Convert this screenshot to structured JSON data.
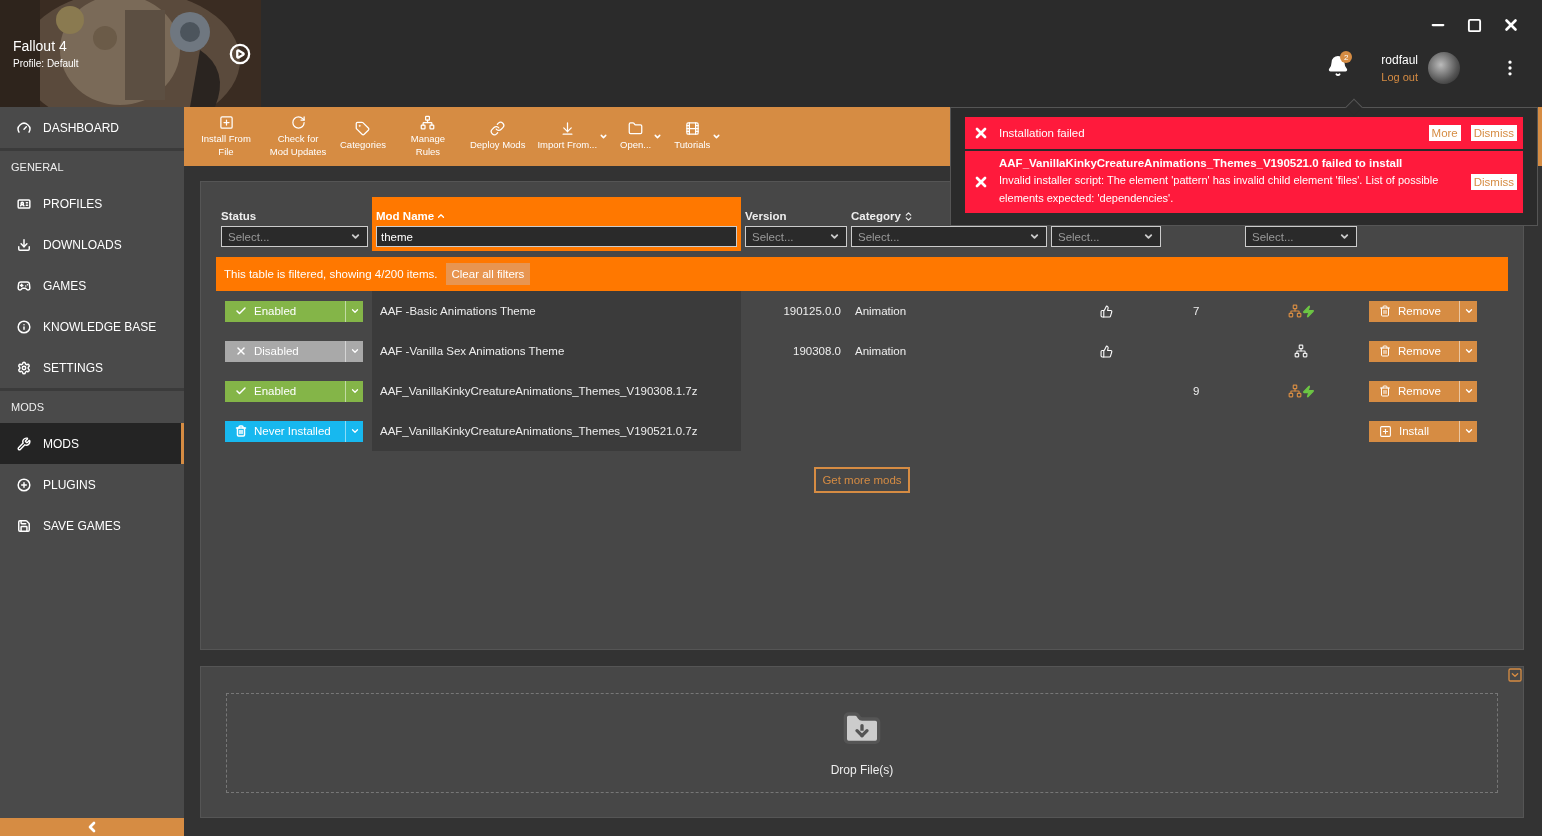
{
  "game": {
    "title": "Fallout 4",
    "profile": "Profile: Default"
  },
  "user": {
    "name": "rodfaul",
    "logout": "Log out",
    "notification_count": "2"
  },
  "sidebar": {
    "items": [
      {
        "kind": "item",
        "label": "DASHBOARD",
        "selected": false
      },
      {
        "kind": "section",
        "label": "GENERAL"
      },
      {
        "kind": "item",
        "label": "PROFILES",
        "selected": false
      },
      {
        "kind": "item",
        "label": "DOWNLOADS",
        "selected": false
      },
      {
        "kind": "item",
        "label": "GAMES",
        "selected": false
      },
      {
        "kind": "item",
        "label": "KNOWLEDGE BASE",
        "selected": false
      },
      {
        "kind": "item",
        "label": "SETTINGS",
        "selected": false
      },
      {
        "kind": "section",
        "label": "MODS"
      },
      {
        "kind": "item",
        "label": "MODS",
        "selected": true
      },
      {
        "kind": "item",
        "label": "PLUGINS",
        "selected": false
      },
      {
        "kind": "item",
        "label": "SAVE GAMES",
        "selected": false
      }
    ]
  },
  "toolbar": [
    {
      "label": "Install From File",
      "dropdown": false
    },
    {
      "label": "Check for Mod Updates",
      "dropdown": false
    },
    {
      "label": "Categories",
      "dropdown": false
    },
    {
      "label": "Manage Rules",
      "dropdown": false
    },
    {
      "label": "Deploy Mods",
      "dropdown": false
    },
    {
      "label": "Import From...",
      "dropdown": true
    },
    {
      "label": "Open...",
      "dropdown": true
    },
    {
      "label": "Tutorials",
      "dropdown": true
    }
  ],
  "notifications": [
    {
      "title": "Installation failed",
      "actions": [
        "More",
        "Dismiss"
      ]
    },
    {
      "title": "AAF_VanillaKinkyCreatureAnimations_Themes_V190521.0 failed to install",
      "message": "Invalid installer script: The element 'pattern' has invalid child element 'files'. List of possible elements expected: 'dependencies'.",
      "actions": [
        "Dismiss"
      ]
    }
  ],
  "table": {
    "columns": [
      {
        "label": "Status",
        "sorted": false,
        "sort_toggle": false,
        "selected": false,
        "filter": {
          "kind": "select",
          "placeholder": "Select..."
        }
      },
      {
        "label": "Mod Name",
        "sorted": true,
        "sort_toggle": false,
        "selected": true,
        "filter": {
          "kind": "text",
          "value": "theme"
        }
      },
      {
        "label": "Version",
        "sorted": false,
        "sort_toggle": false,
        "selected": false,
        "filter": {
          "kind": "select",
          "placeholder": "Select..."
        }
      },
      {
        "label": "Category",
        "sorted": false,
        "sort_toggle": true,
        "selected": false,
        "filter": {
          "kind": "select",
          "placeholder": "Select..."
        }
      },
      {
        "filter": {
          "kind": "select",
          "placeholder": "Select..."
        }
      },
      {},
      {
        "filter": {
          "kind": "select",
          "placeholder": "Select..."
        }
      },
      {}
    ],
    "filter_notice": "This table is filtered, showing 4/200 items.",
    "clear_filters": "Clear all filters",
    "rows": [
      {
        "status": {
          "kind": "enabled",
          "label": "Enabled"
        },
        "name": "AAF -Basic Animations Theme",
        "version": "190125.0.0",
        "category": "Animation",
        "endorse": true,
        "count": "7",
        "rules": true,
        "rules_active": true,
        "action": {
          "kind": "remove",
          "label": "Remove"
        }
      },
      {
        "status": {
          "kind": "disabled",
          "label": "Disabled"
        },
        "name": "AAF -Vanilla Sex Animations Theme",
        "version": "190308.0",
        "category": "Animation",
        "endorse": true,
        "rules": true,
        "rules_active": false,
        "action": {
          "kind": "remove",
          "label": "Remove"
        }
      },
      {
        "status": {
          "kind": "enabled",
          "label": "Enabled"
        },
        "name": "AAF_VanillaKinkyCreatureAnimations_Themes_V190308.1.7z",
        "endorse": false,
        "count": "9",
        "rules": true,
        "rules_active": true,
        "action": {
          "kind": "remove",
          "label": "Remove"
        }
      },
      {
        "status": {
          "kind": "never",
          "label": "Never Installed"
        },
        "name": "AAF_VanillaKinkyCreatureAnimations_Themes_V190521.0.7z",
        "endorse": false,
        "rules": false,
        "action": {
          "kind": "install",
          "label": "Install"
        }
      }
    ]
  },
  "get_more": "Get more mods",
  "dropzone": {
    "label": "Drop File(s)"
  }
}
